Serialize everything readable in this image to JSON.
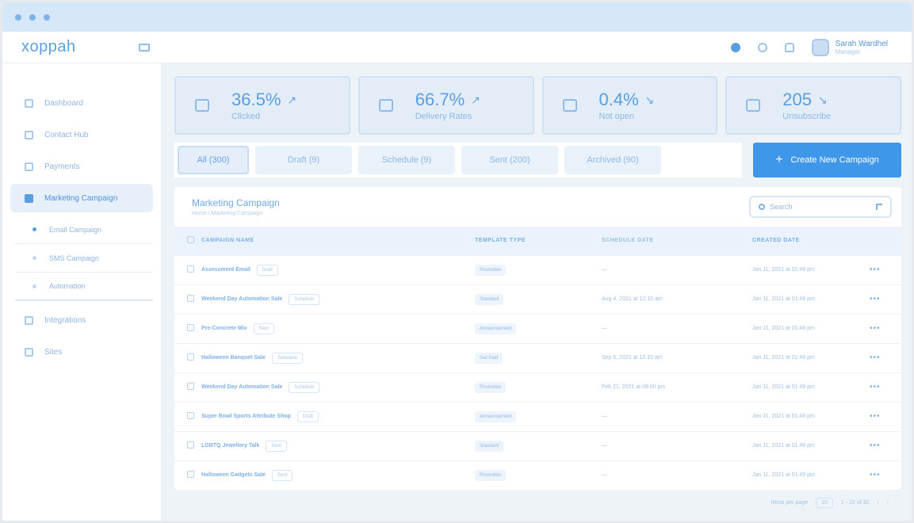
{
  "app": {
    "logo": "xoppah"
  },
  "user": {
    "name": "Sarah Wardhel",
    "role": "Manager"
  },
  "sidebar": {
    "items": [
      {
        "label": "Dashboard"
      },
      {
        "label": "Contact Hub"
      },
      {
        "label": "Payments"
      },
      {
        "label": "Marketing Campaign"
      }
    ],
    "sub_items": [
      {
        "label": "Email Campaign"
      },
      {
        "label": "SMS Campaign"
      },
      {
        "label": "Automation"
      }
    ],
    "bottom_items": [
      {
        "label": "Integrations"
      },
      {
        "label": "Sites"
      }
    ]
  },
  "stats": [
    {
      "value": "36.5%",
      "label": "Clicked",
      "trend": "up"
    },
    {
      "value": "66.7%",
      "label": "Delivery Rates",
      "trend": "up"
    },
    {
      "value": "0.4%",
      "label": "Not open",
      "trend": "down"
    },
    {
      "value": "205",
      "label": "Unsubscribe",
      "trend": "down"
    }
  ],
  "tabs": [
    {
      "label": "All (300)"
    },
    {
      "label": "Draft (9)"
    },
    {
      "label": "Schedule (9)"
    },
    {
      "label": "Sent (200)"
    },
    {
      "label": "Archived (90)"
    }
  ],
  "create_button": {
    "label": "Create New Campaign"
  },
  "card": {
    "title": "Marketing Campaign",
    "breadcrumb": "Home  /  Marketing Campaign",
    "search_placeholder": "Search"
  },
  "table": {
    "headers": [
      "CAMPAIGN NAME",
      "TEMPLATE TYPE",
      "SCHEDULE DATE",
      "CREATED DATE"
    ],
    "rows": [
      {
        "name": "Assessment Email",
        "status": "Draft",
        "type": "Promotion",
        "schedule": "—",
        "created": "Jan 11, 2021 at 01:49 pm"
      },
      {
        "name": "Weekend Day Automation Sale",
        "status": "Schedule",
        "type": "Standard",
        "schedule": "Aug 4, 2021 at 12:10 am",
        "created": "Jan 11, 2021 at 01:49 pm"
      },
      {
        "name": "Pre-Concrete Mix",
        "status": "Sent",
        "type": "Announcement",
        "schedule": "—",
        "created": "Jan 11, 2021 at 01:49 pm"
      },
      {
        "name": "Halloween Banquet Sale",
        "status": "Schedule",
        "type": "Get Paid",
        "schedule": "Sep 6, 2021 at 12:10 am",
        "created": "Jan 11, 2021 at 01:49 pm"
      },
      {
        "name": "Weekend Day Automation Sale",
        "status": "Schedule",
        "type": "Promotion",
        "schedule": "Feb 21, 2021 at 09:00 pm",
        "created": "Jan 11, 2021 at 01:49 pm"
      },
      {
        "name": "Super Bowl Sports Attribute Shop",
        "status": "Draft",
        "type": "Announcement",
        "schedule": "—",
        "created": "Jan 11, 2021 at 01:49 pm"
      },
      {
        "name": "LGBTQ Jewellery Talk",
        "status": "Sent",
        "type": "Standard",
        "schedule": "—",
        "created": "Jan 11, 2021 at 01:49 pm"
      },
      {
        "name": "Halloween Gadgets Sale",
        "status": "Sent",
        "type": "Promotion",
        "schedule": "—",
        "created": "Jan 11, 2021 at 01:49 pm"
      }
    ]
  },
  "pagination": {
    "per_page_label": "Items per page",
    "per_page_value": "10",
    "range": "1 - 10 of 30"
  },
  "colors": {
    "accent": "#3f97ea",
    "sidebar_active": "#e6f0fb"
  }
}
